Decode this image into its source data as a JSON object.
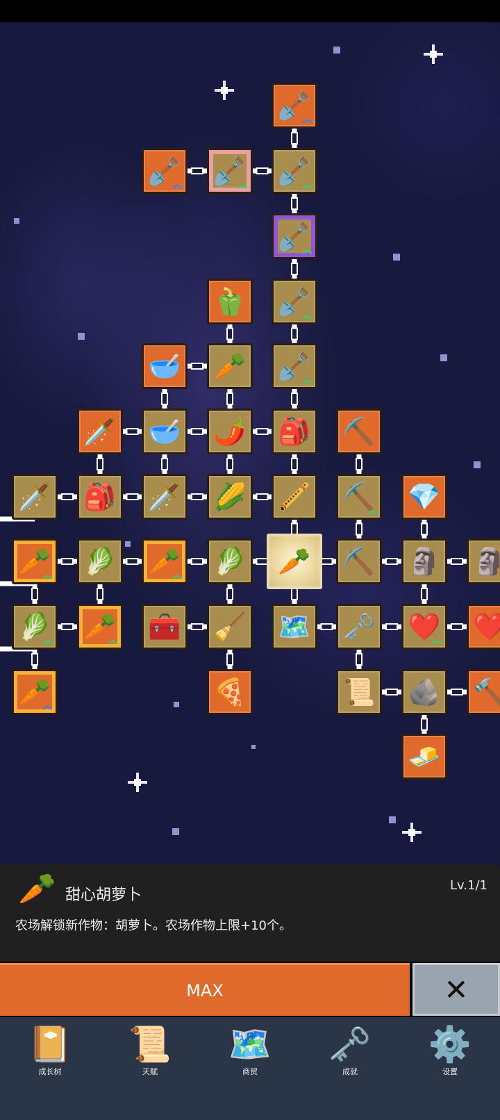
{
  "tree_nodes": [
    {
      "id": "shovel-top",
      "icon": "🪏",
      "style": "orange",
      "arrow": "blue"
    },
    {
      "id": "shovel-r2-left",
      "icon": "🪏",
      "style": "orange",
      "arrow": "blue"
    },
    {
      "id": "shovel-r2-mid",
      "icon": "🪏",
      "style": "pink",
      "arrow": "green"
    },
    {
      "id": "shovel-r2-right",
      "icon": "🪏",
      "style": "tan",
      "arrow": "green"
    },
    {
      "id": "shovel-r3",
      "icon": "🪏",
      "style": "purple",
      "arrow": "green"
    },
    {
      "id": "pepper",
      "icon": "🫑",
      "style": "orange"
    },
    {
      "id": "shovel-r4",
      "icon": "🪏",
      "style": "tan",
      "arrow": "green"
    },
    {
      "id": "bowl-soup",
      "icon": "🥣",
      "style": "orange"
    },
    {
      "id": "radish",
      "icon": "🥕",
      "style": "tan"
    },
    {
      "id": "shovel-r5",
      "icon": "🪏",
      "style": "tan",
      "arrow": "green"
    },
    {
      "id": "golden-sword",
      "icon": "🗡️",
      "style": "orange"
    },
    {
      "id": "bowl",
      "icon": "🥣",
      "style": "tan"
    },
    {
      "id": "chili",
      "icon": "🌶️",
      "style": "tan"
    },
    {
      "id": "backpack-r6",
      "icon": "🎒",
      "style": "tan"
    },
    {
      "id": "pickaxe-r6",
      "icon": "⛏️",
      "style": "orange"
    },
    {
      "id": "sword-1",
      "icon": "🗡️",
      "style": "tan"
    },
    {
      "id": "backpack-r7",
      "icon": "🎒",
      "style": "tan"
    },
    {
      "id": "sword-2",
      "icon": "🗡️",
      "style": "tan"
    },
    {
      "id": "corn",
      "icon": "🌽",
      "style": "tan"
    },
    {
      "id": "flute",
      "icon": "🪈",
      "style": "tan"
    },
    {
      "id": "pickaxe-r7",
      "icon": "⛏️",
      "style": "tan",
      "arrow": "green"
    },
    {
      "id": "crystal",
      "icon": "💎",
      "style": "orange"
    },
    {
      "id": "carrot-r8-1",
      "icon": "🥕",
      "style": "orange carrot-tile",
      "arrow": "green"
    },
    {
      "id": "cabbage-r8-1",
      "icon": "🥬",
      "style": "tan"
    },
    {
      "id": "carrot-r8-2",
      "icon": "🥕",
      "style": "orange carrot-tile",
      "arrow": "green"
    },
    {
      "id": "cabbage-r8-2",
      "icon": "🥬",
      "style": "tan"
    },
    {
      "id": "carrot-selected",
      "icon": "🥕",
      "style": "selected"
    },
    {
      "id": "pickaxe-r8",
      "icon": "⛏️",
      "style": "tan"
    },
    {
      "id": "statue",
      "icon": "🗿",
      "style": "tan"
    },
    {
      "id": "statue-edge",
      "icon": "🗿",
      "style": "tan"
    },
    {
      "id": "cabbage-r9",
      "icon": "🥬",
      "style": "tan",
      "arrow": "green"
    },
    {
      "id": "carrot-r9",
      "icon": "🥕",
      "style": "orange carrot-tile",
      "arrow": "green"
    },
    {
      "id": "chest",
      "icon": "🧰",
      "style": "tan"
    },
    {
      "id": "broom",
      "icon": "🧹",
      "style": "tan"
    },
    {
      "id": "map",
      "icon": "🗺️",
      "style": "tan"
    },
    {
      "id": "key",
      "icon": "🗝️",
      "style": "tan"
    },
    {
      "id": "heart",
      "icon": "❤️",
      "style": "tan",
      "arrow": "green"
    },
    {
      "id": "heart-edge",
      "icon": "❤️",
      "style": "orange"
    },
    {
      "id": "carrot-r10",
      "icon": "🥕",
      "style": "orange carrot-tile",
      "arrow": "blue"
    },
    {
      "id": "pizza",
      "icon": "🍕",
      "style": "orange"
    },
    {
      "id": "scroll",
      "icon": "📜",
      "style": "tan"
    },
    {
      "id": "stone",
      "icon": "🪨",
      "style": "tan"
    },
    {
      "id": "hammer-edge",
      "icon": "🔨",
      "style": "orange"
    },
    {
      "id": "butter",
      "icon": "🧈",
      "style": "orange"
    }
  ],
  "selected_item": {
    "icon": "🥕",
    "name": "甜心胡萝卜",
    "level": "Lv.1/1",
    "description": "农场解锁新作物：胡萝卜。农场作物上限+10个。"
  },
  "actions": {
    "max_label": "MAX",
    "close_symbol": "✕"
  },
  "nav": [
    {
      "id": "growth-tree",
      "icon": "📔",
      "label": "成长树"
    },
    {
      "id": "talent",
      "icon": "📜",
      "label": "天赋"
    },
    {
      "id": "trade",
      "icon": "🗺️",
      "label": "商贸"
    },
    {
      "id": "achievement",
      "icon": "🗝️",
      "label": "成就"
    },
    {
      "id": "settings",
      "icon": "⚙️",
      "label": "设置"
    }
  ],
  "colors": {
    "tile_tan": "#a88d4e",
    "tile_orange": "#e06a2b",
    "panel_bg": "#202020",
    "nav_bg": "#2a3647",
    "close_bg": "#9aa4ae"
  }
}
